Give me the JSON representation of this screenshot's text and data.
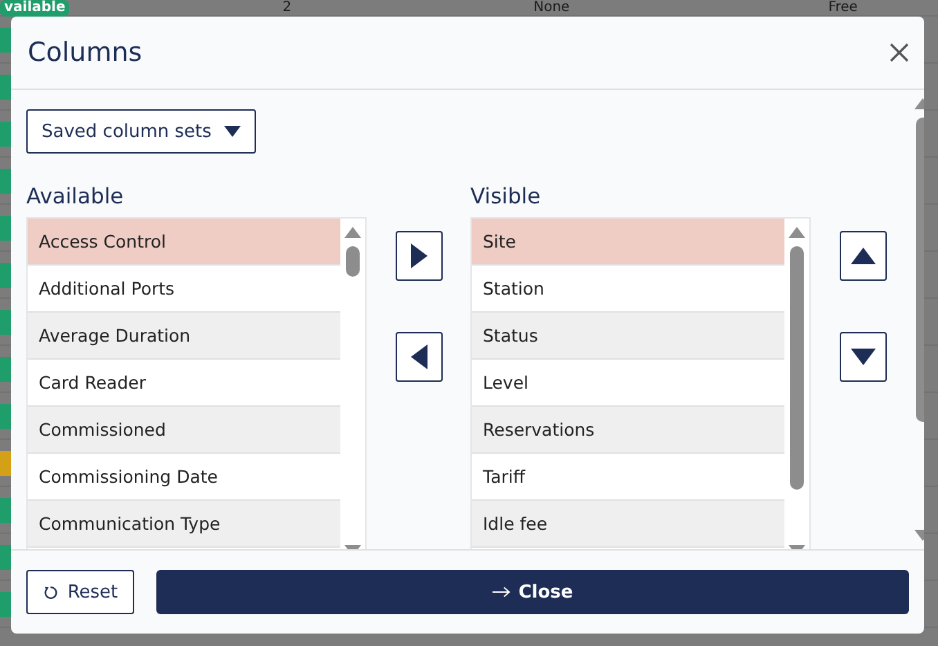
{
  "background": {
    "rows": [
      {
        "color": "#1f9d6b",
        "cells": [
          "vailable",
          "2",
          "None",
          "Free"
        ]
      },
      {
        "color": "#1f9d6b"
      },
      {
        "color": "#1f9d6b"
      },
      {
        "color": "#1f9d6b"
      },
      {
        "color": "#1f9d6b"
      },
      {
        "color": "#1f9d6b"
      },
      {
        "color": "#1f9d6b"
      },
      {
        "color": "#1f9d6b"
      },
      {
        "color": "#1f9d6b"
      },
      {
        "color": "#1f9d6b"
      },
      {
        "color": "#d4a017"
      },
      {
        "color": "#1f9d6b"
      },
      {
        "color": "#1f9d6b"
      },
      {
        "color": "#1f9d6b"
      }
    ]
  },
  "dialog": {
    "title": "Columns",
    "saved_sets": {
      "label": "Saved column sets"
    },
    "available": {
      "heading": "Available",
      "items": [
        {
          "label": "Access Control",
          "selected": true
        },
        {
          "label": "Additional Ports",
          "selected": false
        },
        {
          "label": "Average Duration",
          "selected": false
        },
        {
          "label": "Card Reader",
          "selected": false
        },
        {
          "label": "Commissioned",
          "selected": false
        },
        {
          "label": "Commissioning Date",
          "selected": false
        },
        {
          "label": "Communication Type",
          "selected": false
        }
      ]
    },
    "visible": {
      "heading": "Visible",
      "items": [
        {
          "label": "Site",
          "selected": true
        },
        {
          "label": "Station",
          "selected": false
        },
        {
          "label": "Status",
          "selected": false
        },
        {
          "label": "Level",
          "selected": false
        },
        {
          "label": "Reservations",
          "selected": false
        },
        {
          "label": "Tariff",
          "selected": false
        },
        {
          "label": "Idle fee",
          "selected": false
        }
      ]
    },
    "footer": {
      "reset": "Reset",
      "close": "Close"
    }
  }
}
